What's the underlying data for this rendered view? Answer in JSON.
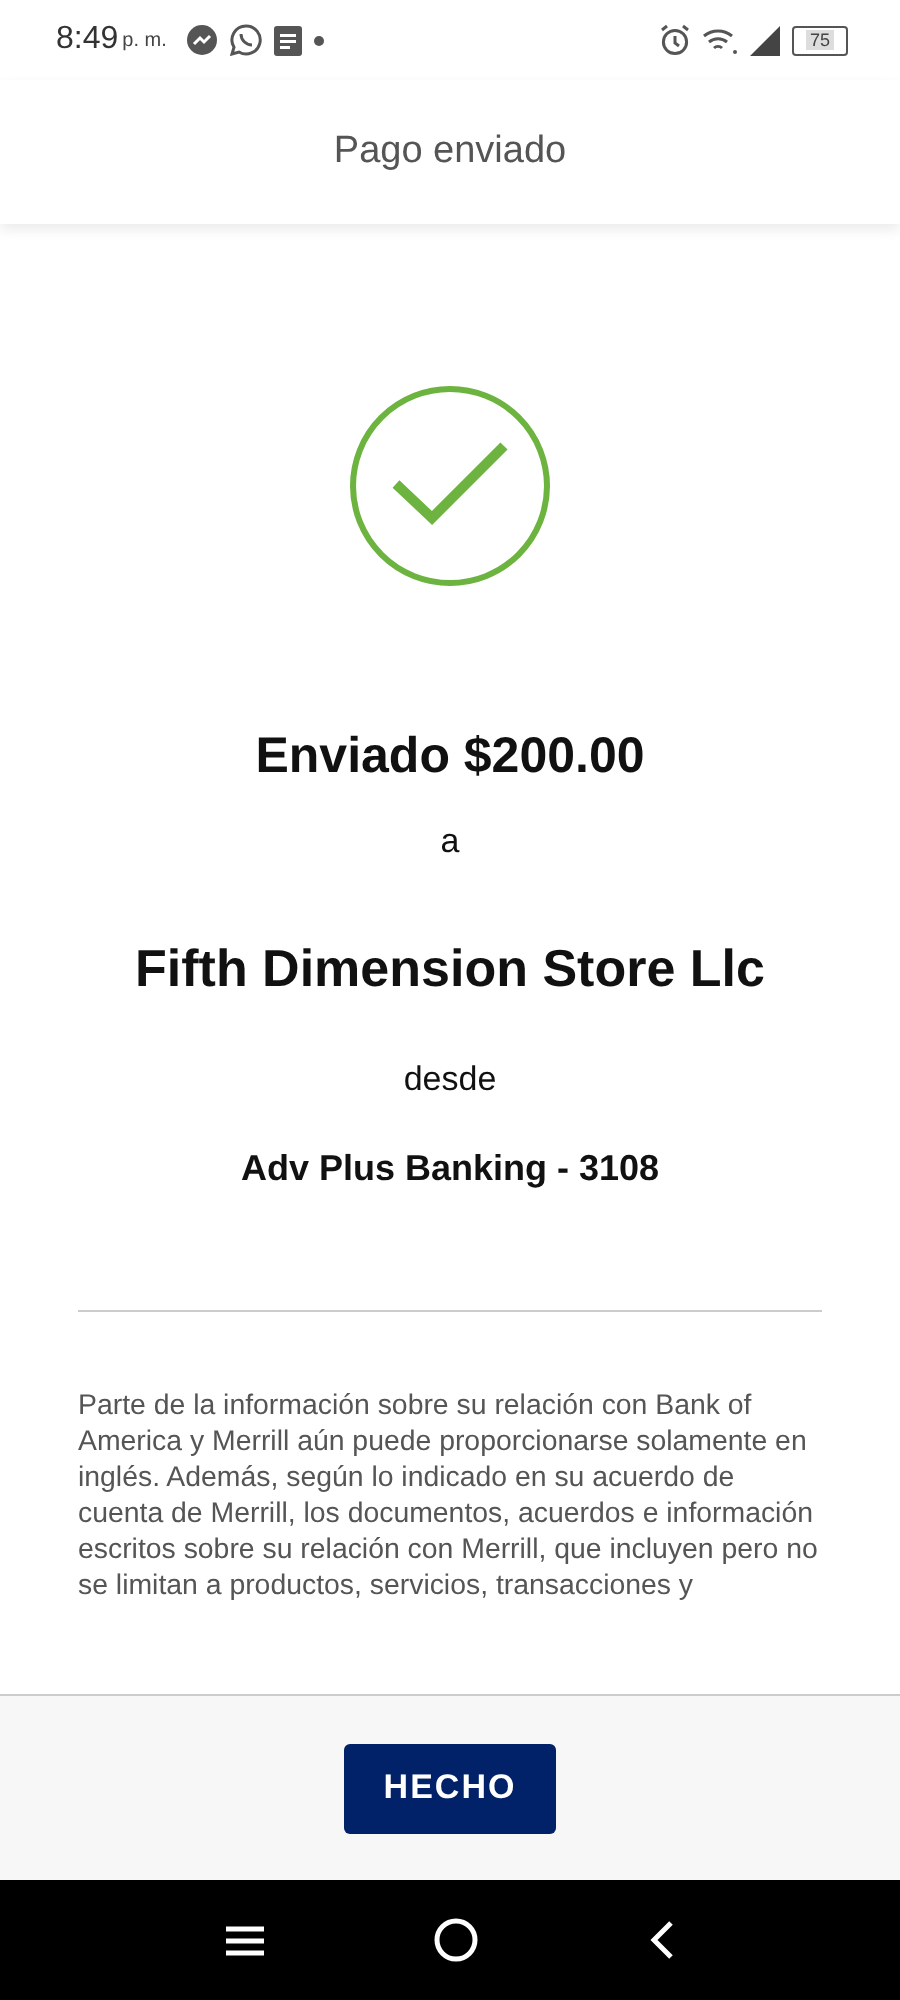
{
  "status_bar": {
    "time": "8:49",
    "period": "p. m.",
    "battery": "75"
  },
  "header": {
    "title": "Pago enviado"
  },
  "confirmation": {
    "amount_line": "Enviado $200.00",
    "to_label": "a",
    "recipient": "Fifth Dimension Store Llc",
    "from_label": "desde",
    "account": "Adv Plus Banking - 3108"
  },
  "disclaimer": "Parte de la información sobre su relación con Bank of America y Merrill aún puede proporcionarse solamente en inglés. Además, según lo indicado en su acuerdo de cuenta de Merrill, los documentos, acuerdos e información escritos sobre su relación con Merrill, que incluyen pero no se limitan a productos, servicios, transacciones y",
  "footer": {
    "button": "HECHO"
  }
}
